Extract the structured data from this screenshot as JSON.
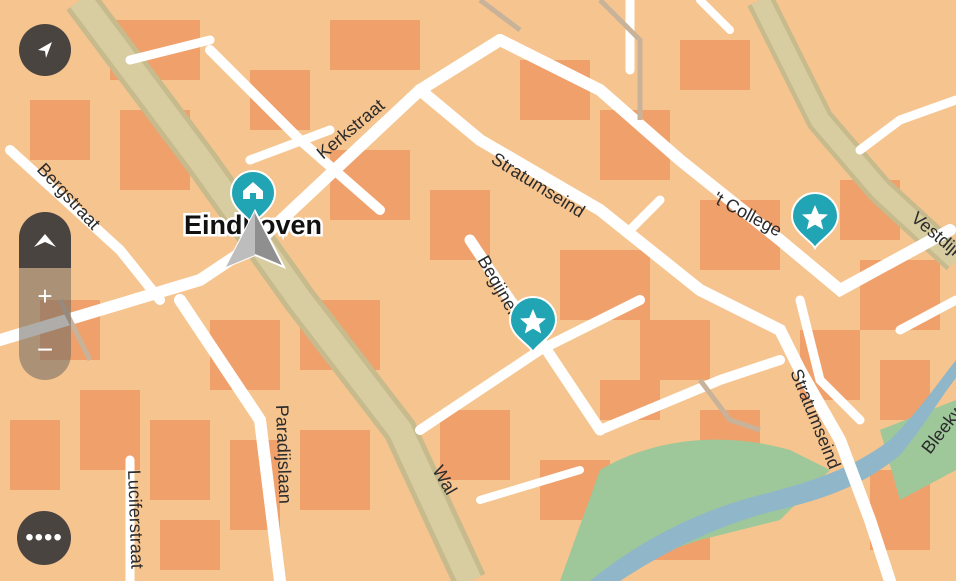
{
  "map": {
    "city": "Eindhoven",
    "streets": {
      "kerkstraat": "Kerkstraat",
      "bergstraat": "Bergstraat",
      "stratumseind_1": "Stratumseind",
      "stratumseind_2": "Stratumseind",
      "t_college": "'t College",
      "vestdijk": "Vestdijk",
      "begijnenhof": "Begijnenhof",
      "paradijslaan": "Paradijslaan",
      "luciferstraat": "Luciferstraat",
      "wal": "Wal",
      "bleekweg": "Bleekweg"
    },
    "markers": {
      "home": "home-icon",
      "favorites": [
        "star-icon",
        "star-icon"
      ],
      "current_location": "navigation-arrow-icon"
    }
  },
  "controls": {
    "back": "back-arrow-icon",
    "zoom_mode": "chevron-up-icon",
    "zoom_in": "+",
    "zoom_out": "−",
    "more": "••••"
  },
  "colors": {
    "block": "#f0a06b",
    "land": "#f6c48f",
    "road": "#ffffff",
    "main_road": "#c7ba8c",
    "water": "#8fb7c9",
    "park": "#9ec79a",
    "marker": "#21a4b4",
    "control": "#4a4440"
  }
}
